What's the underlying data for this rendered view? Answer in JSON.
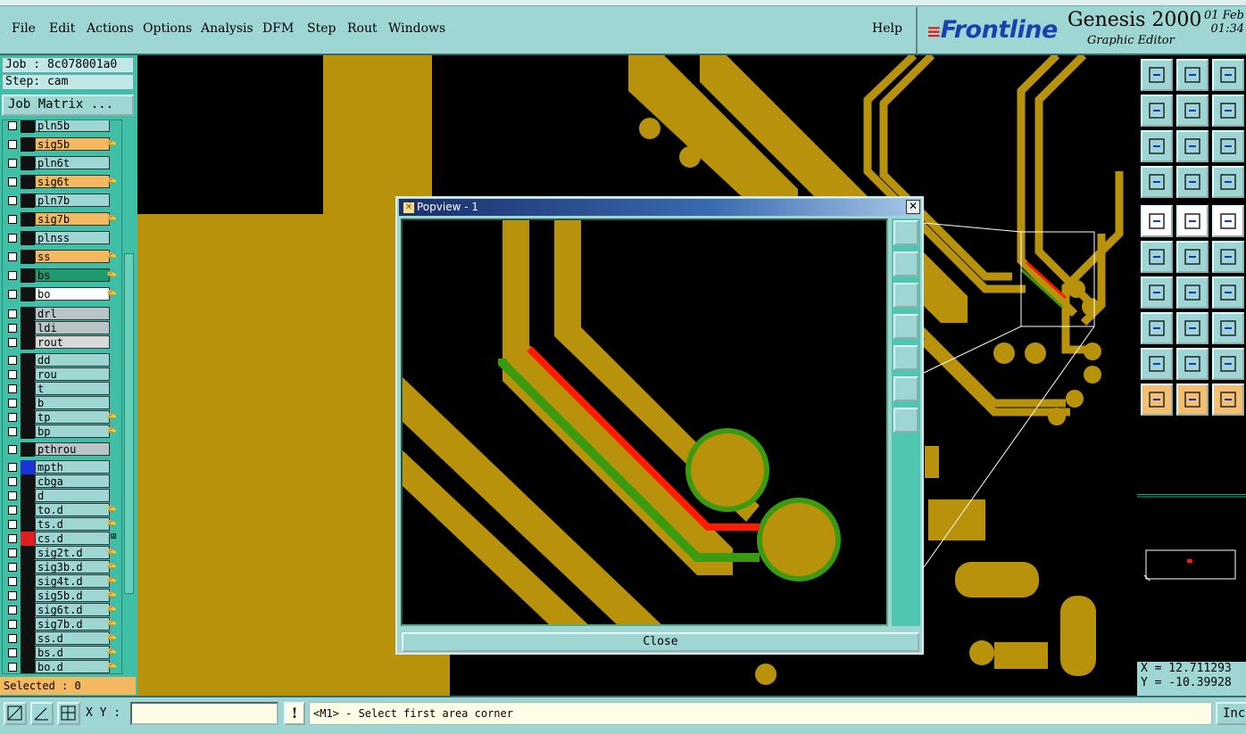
{
  "menu": {
    "file": "File",
    "edit": "Edit",
    "actions": "Actions",
    "options": "Options",
    "analysis": "Analysis",
    "dfm": "DFM",
    "step": "Step",
    "rout": "Rout",
    "windows": "Windows",
    "help": "Help"
  },
  "brand": {
    "logo": "Frontline",
    "product": "Genesis 2000",
    "subtitle": "Graphic Editor",
    "date": "01 Feb",
    "time": "01:34"
  },
  "job": {
    "job_line": "Job : 8c078001a0",
    "step_line": "Step: cam",
    "matrix_button": "Job Matrix ..."
  },
  "layers": [
    {
      "name": "pln5b",
      "bg": "#9ed6d4",
      "color": "#111",
      "tag": ""
    },
    {
      "name": "sig5b",
      "bg": "#f4b860",
      "color": "#111",
      "tag": "✍"
    },
    {
      "name": "pln6t",
      "bg": "#9ed6d4",
      "color": "#111",
      "tag": ""
    },
    {
      "name": "sig6t",
      "bg": "#f4b860",
      "color": "#111",
      "tag": "✍"
    },
    {
      "name": "pln7b",
      "bg": "#9ed6d4",
      "color": "#111",
      "tag": ""
    },
    {
      "name": "sig7b",
      "bg": "#f4b860",
      "color": "#111",
      "tag": "✍"
    },
    {
      "name": "plnss",
      "bg": "#9ed6d4",
      "color": "#111",
      "tag": ""
    },
    {
      "name": "ss",
      "bg": "#f4b860",
      "color": "#111",
      "tag": "✍"
    },
    {
      "name": "bs",
      "bg": "#1f9a6e",
      "color": "#111",
      "tag": "✍"
    },
    {
      "name": "bo",
      "bg": "#ffffff",
      "color": "#111",
      "tag": "✍"
    },
    {
      "name": "drl",
      "bg": "#b8c4c8",
      "color": "#111",
      "tag": ""
    },
    {
      "name": "ldi",
      "bg": "#b8c4c8",
      "color": "#111",
      "tag": ""
    },
    {
      "name": "rout",
      "bg": "#d8d8d8",
      "color": "#111",
      "tag": ""
    },
    {
      "name": "dd",
      "bg": "#9ed6d4",
      "color": "#111",
      "tag": ""
    },
    {
      "name": "rou",
      "bg": "#9ed6d4",
      "color": "#111",
      "tag": ""
    },
    {
      "name": "t",
      "bg": "#9ed6d4",
      "color": "#111",
      "tag": ""
    },
    {
      "name": "b",
      "bg": "#9ed6d4",
      "color": "#111",
      "tag": ""
    },
    {
      "name": "tp",
      "bg": "#9ed6d4",
      "color": "#111",
      "tag": "✍"
    },
    {
      "name": "bp",
      "bg": "#9ed6d4",
      "color": "#111",
      "tag": "✍"
    },
    {
      "name": "pthrou",
      "bg": "#b8c4c8",
      "color": "#111",
      "tag": ""
    },
    {
      "name": "mpth",
      "bg": "#9ed6d4",
      "color": "#1a33d6",
      "tag": ""
    },
    {
      "name": "cbga",
      "bg": "#9ed6d4",
      "color": "#111",
      "tag": ""
    },
    {
      "name": "d",
      "bg": "#9ed6d4",
      "color": "#111",
      "tag": ""
    },
    {
      "name": "to.d",
      "bg": "#9ed6d4",
      "color": "#111",
      "tag": "✍"
    },
    {
      "name": "ts.d",
      "bg": "#9ed6d4",
      "color": "#111",
      "tag": "✍"
    },
    {
      "name": "cs.d",
      "bg": "#9ed6d4",
      "color": "#e02020",
      "tag": "⊞"
    },
    {
      "name": "sig2t.d",
      "bg": "#9ed6d4",
      "color": "#111",
      "tag": "✍"
    },
    {
      "name": "sig3b.d",
      "bg": "#9ed6d4",
      "color": "#111",
      "tag": "✍"
    },
    {
      "name": "sig4t.d",
      "bg": "#9ed6d4",
      "color": "#111",
      "tag": "✍"
    },
    {
      "name": "sig5b.d",
      "bg": "#9ed6d4",
      "color": "#111",
      "tag": "✍"
    },
    {
      "name": "sig6t.d",
      "bg": "#9ed6d4",
      "color": "#111",
      "tag": "✍"
    },
    {
      "name": "sig7b.d",
      "bg": "#9ed6d4",
      "color": "#111",
      "tag": "✍"
    },
    {
      "name": "ss.d",
      "bg": "#9ed6d4",
      "color": "#111",
      "tag": "✍"
    },
    {
      "name": "bs.d",
      "bg": "#9ed6d4",
      "color": "#111",
      "tag": "✍"
    },
    {
      "name": "bo.d",
      "bg": "#9ed6d4",
      "color": "#111",
      "tag": "✍"
    }
  ],
  "selected": "Selected : 0",
  "popview": {
    "title": "Popview - 1",
    "close_label": "Close"
  },
  "coords": {
    "x": "X = 12.711293",
    "y": "Y = -10.39928"
  },
  "status": {
    "xy_label": "X Y :",
    "xy_value": "",
    "prompt": "<M1> - Select first area corner",
    "inc": "Inc"
  },
  "colors": {
    "copper": "#b8920a",
    "canvas": "#000000",
    "panel": "#9ed6d4",
    "highlight_red": "#ff1a00",
    "highlight_green": "#3a9a10"
  }
}
